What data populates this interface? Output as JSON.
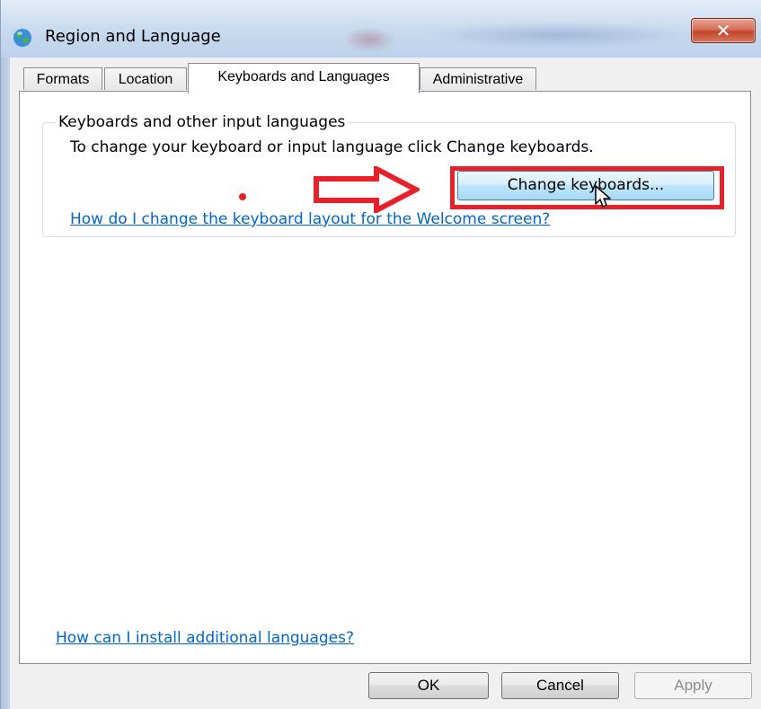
{
  "window": {
    "title": "Region and Language",
    "title_icon": "globe-icon",
    "close_label": "✕",
    "blurred_background_text": "System and Security"
  },
  "tabs": [
    {
      "label": "Formats",
      "active": false
    },
    {
      "label": "Location",
      "active": false
    },
    {
      "label": "Keyboards and Languages",
      "active": true
    },
    {
      "label": "Administrative",
      "active": false
    }
  ],
  "keyboards_group": {
    "title": "Keyboards and other input languages",
    "description": "To change your keyboard or input language click Change keyboards.",
    "change_button_label": "Change keyboards...",
    "welcome_link": "How do I change the keyboard layout for the Welcome screen?"
  },
  "install_link": "How can I install additional languages?",
  "buttons": {
    "ok": "OK",
    "cancel": "Cancel",
    "apply": "Apply"
  },
  "annotations": {
    "highlight_color": "#e8202a",
    "arrow_icon": "right-arrow-icon",
    "cursor_icon": "mouse-pointer-icon"
  }
}
